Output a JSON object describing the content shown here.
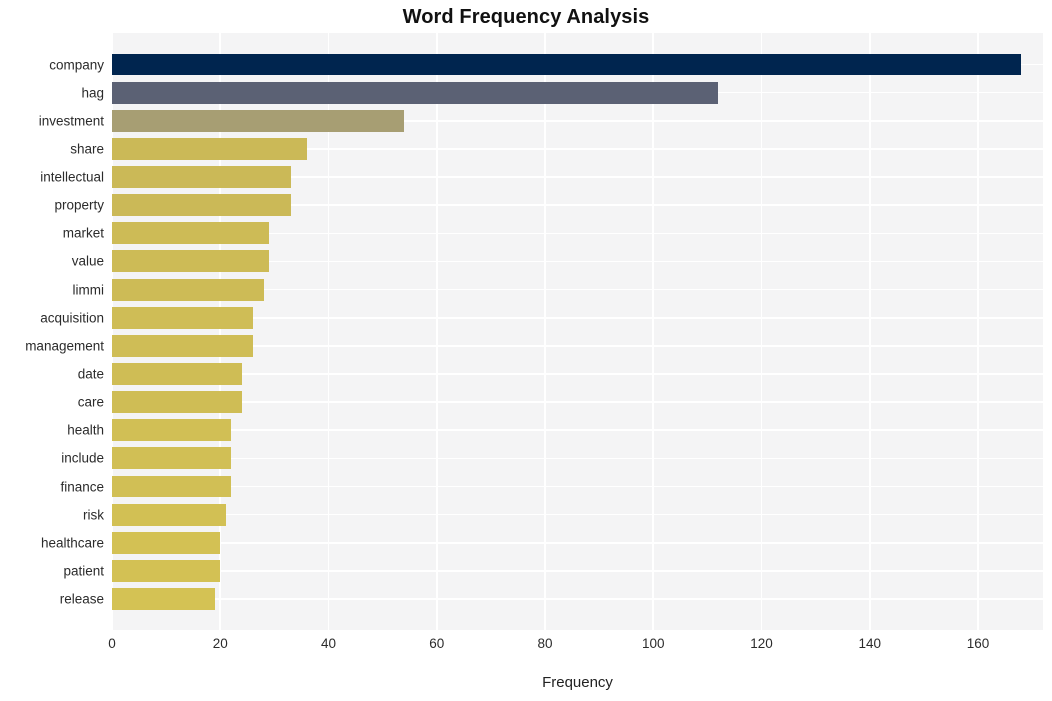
{
  "chart_data": {
    "type": "bar",
    "orientation": "horizontal",
    "title": "Word Frequency Analysis",
    "xlabel": "Frequency",
    "ylabel": "",
    "xlim": [
      0,
      172
    ],
    "xticks": [
      0,
      20,
      40,
      60,
      80,
      100,
      120,
      140,
      160
    ],
    "xtick_labels": [
      "0",
      "20",
      "40",
      "60",
      "80",
      "100",
      "120",
      "140",
      "160"
    ],
    "grid": true,
    "grid_axis": "both",
    "legend": "none",
    "categories": [
      "company",
      "hag",
      "investment",
      "share",
      "intellectual",
      "property",
      "market",
      "value",
      "limmi",
      "acquisition",
      "management",
      "date",
      "care",
      "health",
      "include",
      "finance",
      "risk",
      "healthcare",
      "patient",
      "release"
    ],
    "values": [
      168,
      112,
      54,
      36,
      33,
      33,
      29,
      29,
      28,
      26,
      26,
      24,
      24,
      22,
      22,
      22,
      21,
      20,
      20,
      19
    ],
    "bar_colors": [
      "#00254f",
      "#5b6174",
      "#a79e73",
      "#cbb957",
      "#cbb957",
      "#cbb957",
      "#cdbb56",
      "#cdbb56",
      "#cdbb56",
      "#cfbd56",
      "#cfbd56",
      "#cfbd55",
      "#cfbd55",
      "#d1bf55",
      "#d1bf55",
      "#d1bf55",
      "#d2c054",
      "#d3c154",
      "#d3c154",
      "#d4c254"
    ]
  },
  "style": {
    "plot_background": "#f4f4f5",
    "figure_background": "#ffffff",
    "gridline_color": "#ffffff",
    "text_color": "#2b2b2b",
    "title_color": "#111111"
  }
}
